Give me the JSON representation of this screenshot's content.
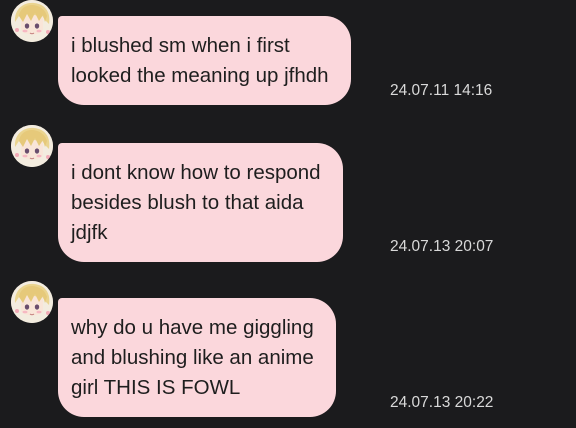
{
  "theme": {
    "background": "#1b1b1d",
    "bubble_color": "#fbd7dc",
    "text_color": "#1e1e1e",
    "timestamp_color": "#d9d9d9"
  },
  "messages": [
    {
      "avatar_icon": "anime-character-avatar-icon",
      "lines": [
        "i blushed sm when i first",
        "looked the meaning up jfhdh"
      ],
      "timestamp": "24.07.11 14:16"
    },
    {
      "avatar_icon": "anime-character-avatar-icon",
      "lines": [
        "i dont know how to respond",
        "besides blush to that aida",
        "jdjfk"
      ],
      "timestamp": "24.07.13 20:07"
    },
    {
      "avatar_icon": "anime-character-avatar-icon",
      "lines": [
        "why do u have me giggling",
        "and blushing like an anime",
        "girl THIS IS FOWL"
      ],
      "timestamp": "24.07.13 20:22"
    }
  ]
}
